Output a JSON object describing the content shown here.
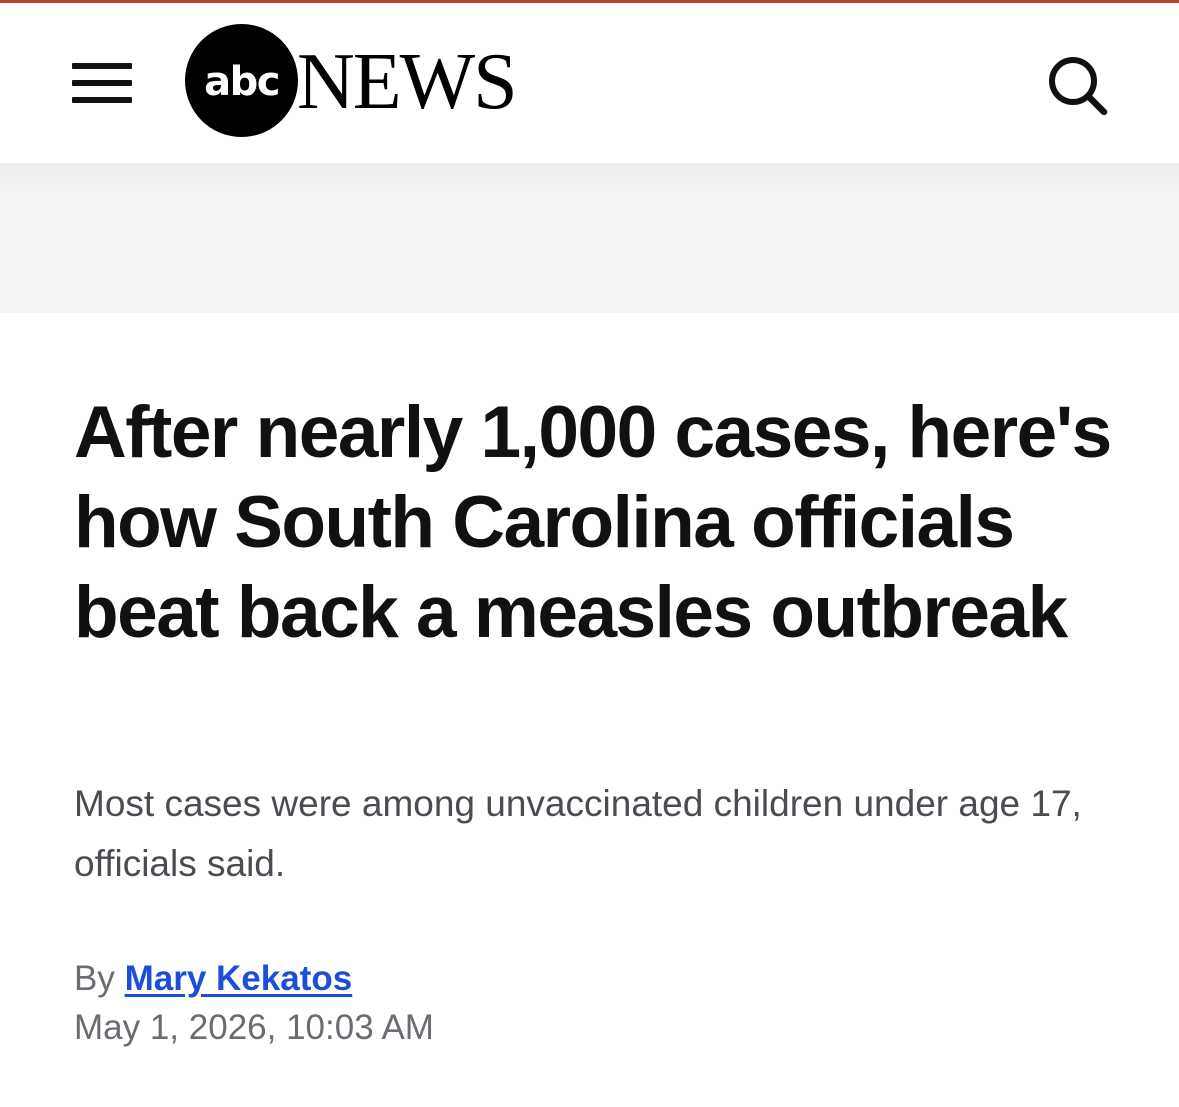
{
  "header": {
    "menu_icon": "hamburger-menu-icon",
    "logo_mark": "abc",
    "logo_wordmark": "NEWS",
    "search_icon": "search-icon"
  },
  "article": {
    "headline": "After nearly 1,000 cases, here's how South Carolina officials beat back a measles outbreak",
    "subhead": "Most cases were among unvaccinated children under age 17, officials said.",
    "byline_prefix": "By",
    "author": "Mary Kekatos",
    "date": "May 1, 2026, 10:03 AM"
  },
  "colors": {
    "accent_top_rule": "#b8412f",
    "author_link": "#1b4fd8",
    "headline": "#111111",
    "muted_text": "#6b6b72"
  }
}
